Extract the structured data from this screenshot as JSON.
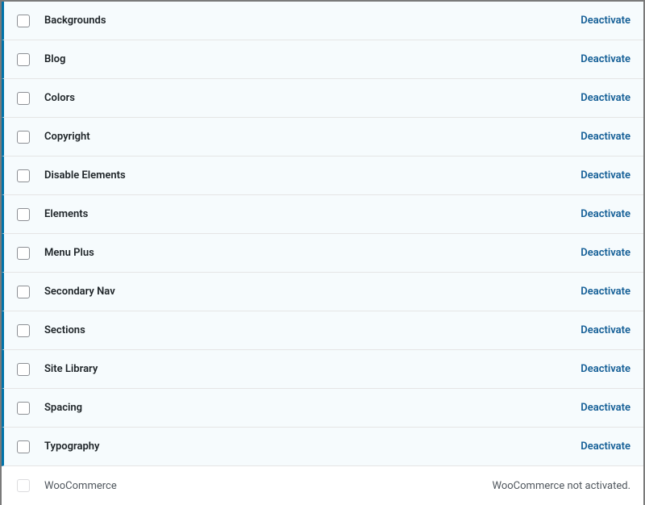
{
  "modules": [
    {
      "name": "Backgrounds",
      "action": "Deactivate",
      "active": true
    },
    {
      "name": "Blog",
      "action": "Deactivate",
      "active": true
    },
    {
      "name": "Colors",
      "action": "Deactivate",
      "active": true
    },
    {
      "name": "Copyright",
      "action": "Deactivate",
      "active": true
    },
    {
      "name": "Disable Elements",
      "action": "Deactivate",
      "active": true
    },
    {
      "name": "Elements",
      "action": "Deactivate",
      "active": true
    },
    {
      "name": "Menu Plus",
      "action": "Deactivate",
      "active": true
    },
    {
      "name": "Secondary Nav",
      "action": "Deactivate",
      "active": true
    },
    {
      "name": "Sections",
      "action": "Deactivate",
      "active": true
    },
    {
      "name": "Site Library",
      "action": "Deactivate",
      "active": true
    },
    {
      "name": "Spacing",
      "action": "Deactivate",
      "active": true
    },
    {
      "name": "Typography",
      "action": "Deactivate",
      "active": true
    },
    {
      "name": "WooCommerce",
      "status": "WooCommerce not activated.",
      "active": false
    }
  ]
}
